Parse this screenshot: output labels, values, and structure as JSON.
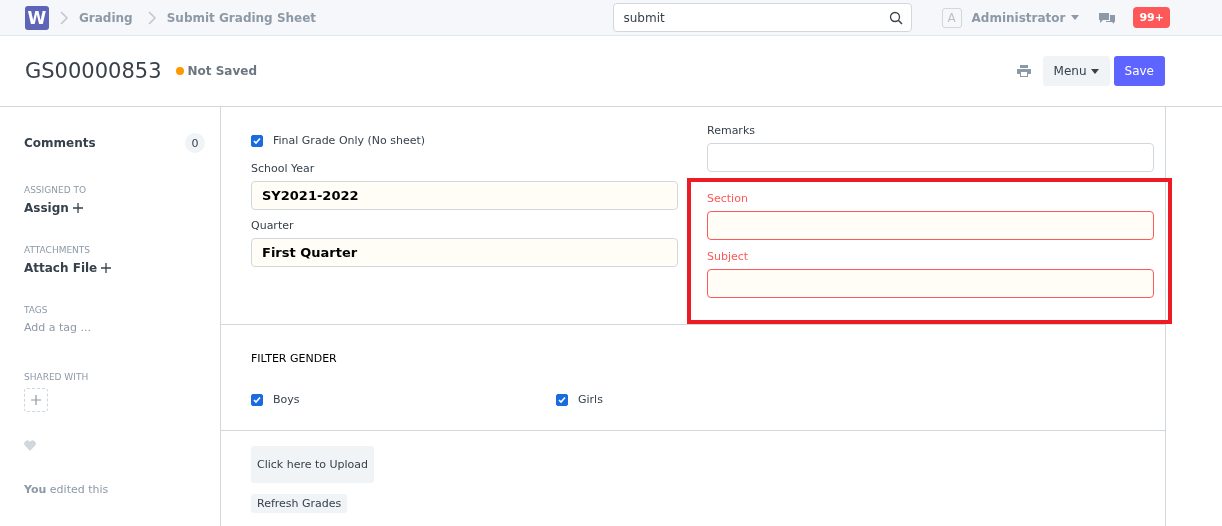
{
  "navbar": {
    "logo": "W",
    "breadcrumbs": [
      "Grading",
      "Submit Grading Sheet"
    ],
    "search": {
      "value": "submit"
    },
    "user": {
      "avatar": "A",
      "name": "Administrator"
    },
    "notifications": "99+"
  },
  "header": {
    "title": "GS00000853",
    "status": {
      "label": "Not Saved",
      "color": "#ff9900"
    },
    "menu": "Menu",
    "save": "Save"
  },
  "sidebar": {
    "comments": {
      "label": "Comments",
      "count": "0"
    },
    "assigned_to": {
      "heading": "ASSIGNED TO",
      "action": "Assign"
    },
    "attachments": {
      "heading": "ATTACHMENTS",
      "action": "Attach File"
    },
    "tags": {
      "heading": "TAGS",
      "placeholder": "Add a tag ..."
    },
    "shared_with": {
      "heading": "SHARED WITH"
    },
    "liked": false,
    "activity": "**You** edited this"
  },
  "form": {
    "final_grade": {
      "label": "Final Grade Only (No sheet)",
      "checked": true
    },
    "left_fields": [
      {
        "label": "School Year",
        "value": "SY2021-2022",
        "error": false
      },
      {
        "label": "Quarter",
        "value": "First Quarter",
        "error": false
      }
    ],
    "remarks": {
      "label": "Remarks",
      "error": false
    },
    "highlighted_fields": [
      {
        "label": "Section",
        "error": true
      },
      {
        "label": "Subject",
        "error": true
      }
    ],
    "filter": {
      "heading": "FILTER GENDER",
      "options": [
        {
          "label": "Boys",
          "checked": true
        },
        {
          "label": "Girls",
          "checked": true
        }
      ]
    },
    "buttons": [
      "Click here to Upload",
      "Refresh Grades"
    ]
  }
}
